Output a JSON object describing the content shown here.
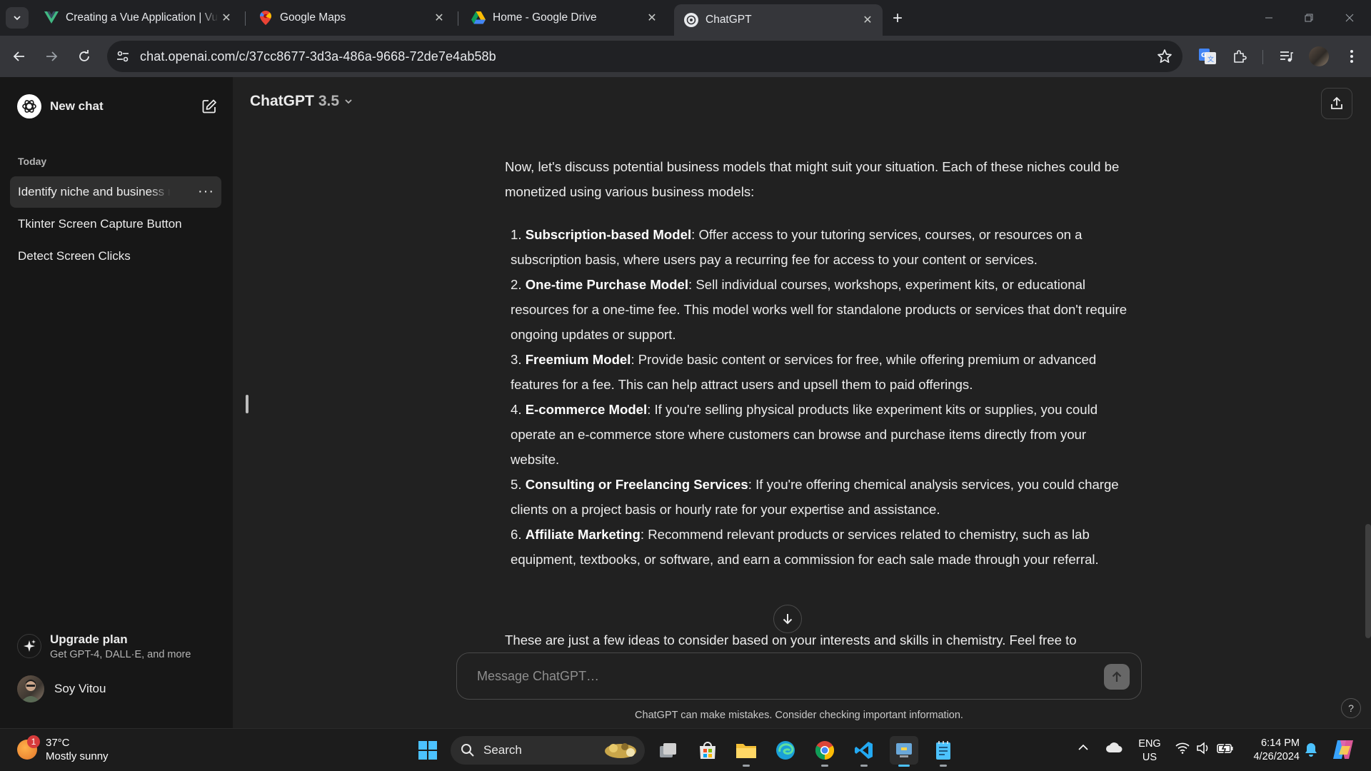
{
  "browser": {
    "tabs": [
      {
        "title": "Creating a Vue Application | Vue.js",
        "icon": "vue-logo"
      },
      {
        "title": "Google Maps",
        "icon": "maps-pin"
      },
      {
        "title": "Home - Google Drive",
        "icon": "drive-logo"
      },
      {
        "title": "ChatGPT",
        "icon": "openai-logo",
        "active": true
      }
    ],
    "url": "chat.openai.com/c/37cc8677-3d3a-486a-9668-72de7e4ab58b"
  },
  "sidebar": {
    "new_chat_label": "New chat",
    "section_today": "Today",
    "history": [
      {
        "title": "Identify niche and business models",
        "active": true
      },
      {
        "title": "Tkinter Screen Capture Button"
      },
      {
        "title": "Detect Screen Clicks"
      }
    ],
    "upgrade": {
      "title": "Upgrade plan",
      "subtitle": "Get GPT-4, DALL·E, and more"
    },
    "user": {
      "name": "Soy Vitou"
    }
  },
  "main": {
    "model": {
      "name": "ChatGPT",
      "version": "3.5"
    },
    "intro": "Now, let's discuss potential business models that might suit your situation. Each of these niches could be monetized using various business models:",
    "items": [
      {
        "num": "1.",
        "bold": "Subscription-based Model",
        "text": ": Offer access to your tutoring services, courses, or resources on a subscription basis, where users pay a recurring fee for access to your content or services."
      },
      {
        "num": "2.",
        "bold": "One-time Purchase Model",
        "text": ": Sell individual courses, workshops, experiment kits, or educational resources for a one-time fee. This model works well for standalone products or services that don't require ongoing updates or support."
      },
      {
        "num": "3.",
        "bold": "Freemium Model",
        "text": ": Provide basic content or services for free, while offering premium or advanced features for a fee. This can help attract users and upsell them to paid offerings."
      },
      {
        "num": "4.",
        "bold": "E-commerce Model",
        "text": ": If you're selling physical products like experiment kits or supplies, you could operate an e-commerce store where customers can browse and purchase items directly from your website."
      },
      {
        "num": "5.",
        "bold": "Consulting or Freelancing Services",
        "text": ": If you're offering chemical analysis services, you could charge clients on a project basis or hourly rate for your expertise and assistance."
      },
      {
        "num": "6.",
        "bold": "Affiliate Marketing",
        "text": ": Recommend relevant products or services related to chemistry, such as lab equipment, textbooks, or software, and earn a commission for each sale made through your referral."
      }
    ],
    "trailing": "These are just a few ideas to consider based on your interests and skills in chemistry. Feel free to",
    "composer_placeholder": "Message ChatGPT…",
    "disclaimer": "ChatGPT can make mistakes. Consider checking important information.",
    "help": "?"
  },
  "taskbar": {
    "weather": {
      "temp": "37°C",
      "condition": "Mostly sunny",
      "badge": "1"
    },
    "search_label": "Search",
    "lang": {
      "l1": "ENG",
      "l2": "US"
    },
    "time": "6:14 PM",
    "date": "4/26/2024"
  },
  "colors": {
    "accent": "#4cc2ff",
    "sidebar_bg": "#171717",
    "main_bg": "#212121"
  }
}
